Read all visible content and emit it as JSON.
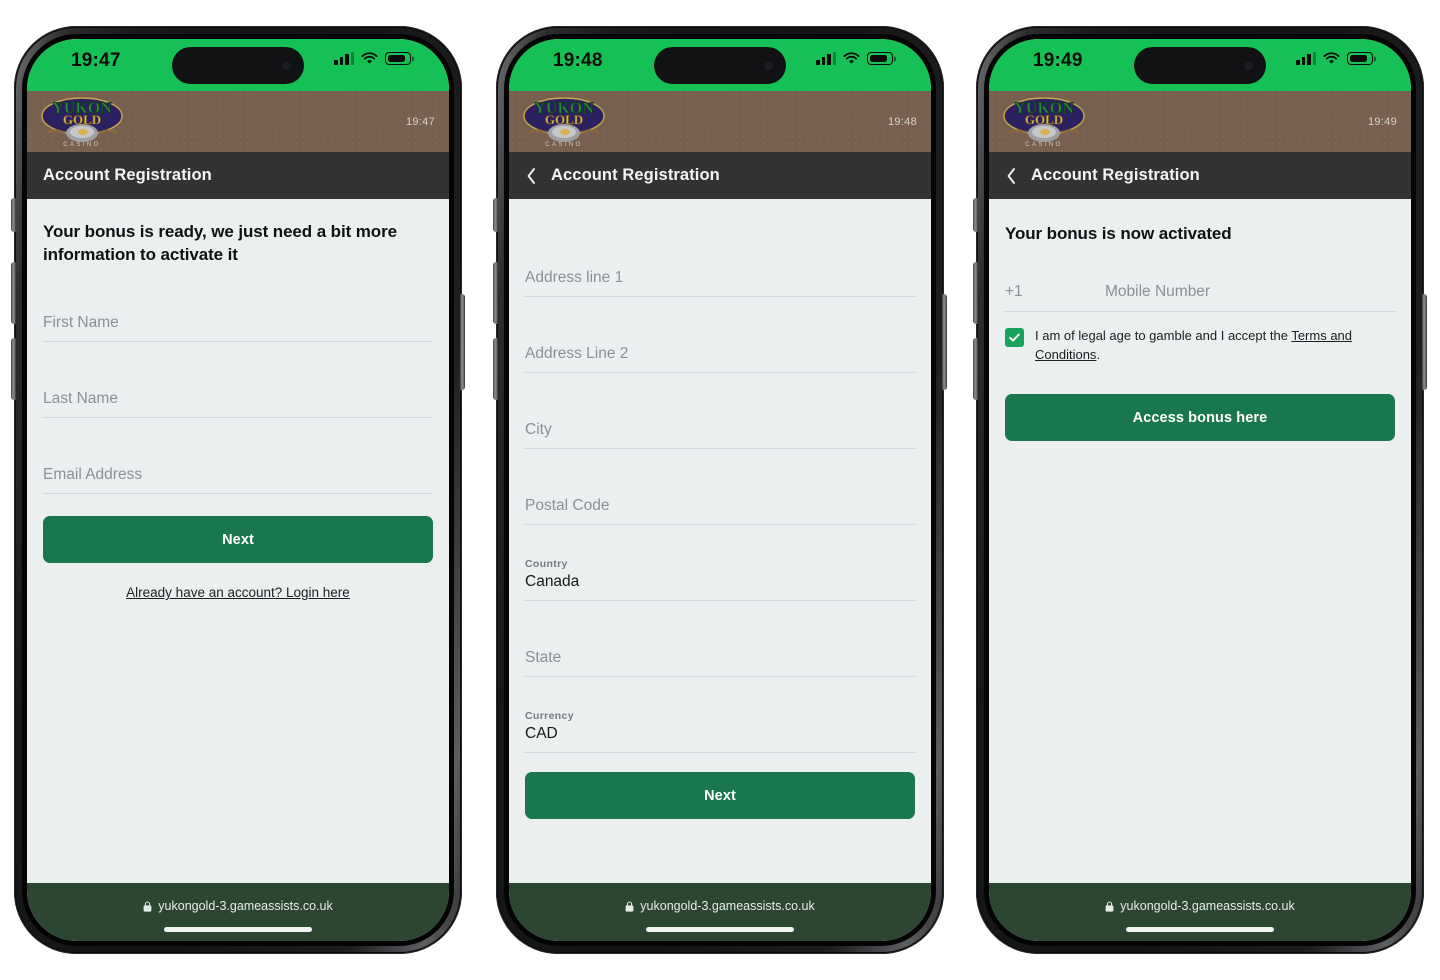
{
  "brand": {
    "logo_line1": "YUKON",
    "logo_line2": "GOLD",
    "logo_line3": "CASINO",
    "colors": {
      "status_green": "#15c154",
      "brand_brown": "#77604f",
      "title_dark": "#333334",
      "button_green": "#18774d",
      "checkbox_green": "#18a35c",
      "browser_green": "#2d4631",
      "page_bg": "#eceff0"
    }
  },
  "browser": {
    "url": "yukongold-3.gameassists.co.uk",
    "lock_icon": "lock-icon"
  },
  "phones": [
    {
      "status_time": "19:47",
      "brand_time": "19:47",
      "title": "Account Registration",
      "has_back": false,
      "heading": "Your bonus is ready, we just need a bit more information to activate it",
      "fields": [
        {
          "placeholder": "First Name",
          "label": "",
          "value": ""
        },
        {
          "placeholder": "Last Name",
          "label": "",
          "value": ""
        },
        {
          "placeholder": "Email Address",
          "label": "",
          "value": ""
        }
      ],
      "primary_button": "Next",
      "login_link": "Already have an account? Login here"
    },
    {
      "status_time": "19:48",
      "brand_time": "19:48",
      "title": "Account Registration",
      "has_back": true,
      "heading": "",
      "fields": [
        {
          "placeholder": "Address line 1",
          "label": "",
          "value": ""
        },
        {
          "placeholder": "Address Line 2",
          "label": "",
          "value": ""
        },
        {
          "placeholder": "City",
          "label": "",
          "value": ""
        },
        {
          "placeholder": "Postal Code",
          "label": "",
          "value": ""
        },
        {
          "placeholder": "",
          "label": "Country",
          "value": "Canada"
        },
        {
          "placeholder": "State",
          "label": "",
          "value": ""
        },
        {
          "placeholder": "",
          "label": "Currency",
          "value": "CAD"
        }
      ],
      "primary_button": "Next"
    },
    {
      "status_time": "19:49",
      "brand_time": "19:49",
      "title": "Account Registration",
      "has_back": true,
      "heading": "Your bonus is now activated",
      "phone_field": {
        "country_code": "+1",
        "placeholder": "Mobile Number"
      },
      "consent": {
        "checked": true,
        "text_before": "I am of legal age to gamble and I accept the ",
        "link_text": "Terms and Conditions",
        "text_after": "."
      },
      "primary_button": "Access bonus here"
    }
  ]
}
